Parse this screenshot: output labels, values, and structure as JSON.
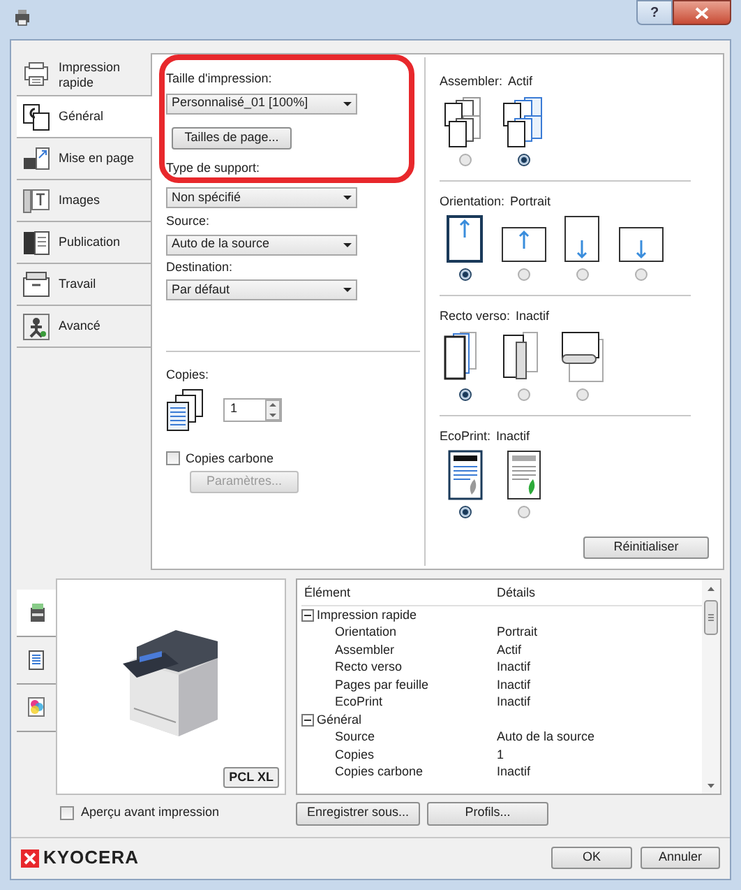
{
  "window": {
    "help_button": "?"
  },
  "sidebar": {
    "items": [
      {
        "label": "Impression rapide",
        "selected": false,
        "kind": "quick"
      },
      {
        "label": "Général",
        "selected": true,
        "kind": "general"
      },
      {
        "label": "Mise en page",
        "selected": false,
        "kind": "layout"
      },
      {
        "label": "Images",
        "selected": false,
        "kind": "images"
      },
      {
        "label": "Publication",
        "selected": false,
        "kind": "publishing"
      },
      {
        "label": "Travail",
        "selected": false,
        "kind": "job"
      },
      {
        "label": "Avancé",
        "selected": false,
        "kind": "advanced"
      }
    ]
  },
  "general": {
    "print_size": {
      "label": "Taille d'impression:",
      "value": "Personnalisé_01 [100%]"
    },
    "page_sizes_button": "Tailles de page...",
    "media_type": {
      "label": "Type de support:",
      "value": "Non spécifié"
    },
    "source": {
      "label": "Source:",
      "value": "Auto de la source"
    },
    "destination": {
      "label": "Destination:",
      "value": "Par défaut"
    },
    "copies": {
      "label": "Copies:",
      "value": "1"
    },
    "carbon_copies": {
      "label": "Copies carbone",
      "checked": false
    },
    "settings_button": {
      "label": "Paramètres...",
      "disabled": true
    }
  },
  "settings_groups": [
    {
      "kind": "collate",
      "label": "Assembler:",
      "value": "Actif",
      "options": [
        {
          "selected": false
        },
        {
          "selected": true
        }
      ]
    },
    {
      "kind": "orientation",
      "label": "Orientation:",
      "value": "Portrait",
      "options": [
        {
          "selected": true
        },
        {
          "selected": false
        },
        {
          "selected": false
        },
        {
          "selected": false
        }
      ]
    },
    {
      "kind": "duplex",
      "label": "Recto verso:",
      "value": "Inactif",
      "options": [
        {
          "selected": true
        },
        {
          "selected": false
        },
        {
          "selected": false
        }
      ]
    },
    {
      "kind": "ecoprint",
      "label": "EcoPrint:",
      "value": "Inactif",
      "options": [
        {
          "selected": true
        },
        {
          "selected": false
        }
      ]
    }
  ],
  "reset_button": "Réinitialiser",
  "preview": {
    "tabs": [
      {
        "kind": "device",
        "selected": true
      },
      {
        "kind": "page",
        "selected": false
      },
      {
        "kind": "color",
        "selected": false
      }
    ],
    "badge": "PCL XL"
  },
  "summary": {
    "columns": [
      "Élément",
      "Détails"
    ],
    "groups": [
      {
        "label": "Impression rapide",
        "expanded": true,
        "children": [
          {
            "name": "Orientation",
            "value": "Portrait"
          },
          {
            "name": "Assembler",
            "value": "Actif"
          },
          {
            "name": "Recto verso",
            "value": "Inactif"
          },
          {
            "name": "Pages par feuille",
            "value": "Inactif"
          },
          {
            "name": "EcoPrint",
            "value": "Inactif"
          }
        ]
      },
      {
        "label": "Général",
        "expanded": true,
        "children": [
          {
            "name": "Source",
            "value": "Auto de la source"
          },
          {
            "name": "Copies",
            "value": "1"
          },
          {
            "name": "Copies carbone",
            "value": "Inactif"
          }
        ]
      }
    ]
  },
  "preview_checkbox": {
    "label": "Aperçu avant impression",
    "checked": false
  },
  "buttons": {
    "save_as": "Enregistrer sous...",
    "profiles": "Profils...",
    "ok": "OK",
    "cancel": "Annuler"
  },
  "brand": "KYOCERA"
}
